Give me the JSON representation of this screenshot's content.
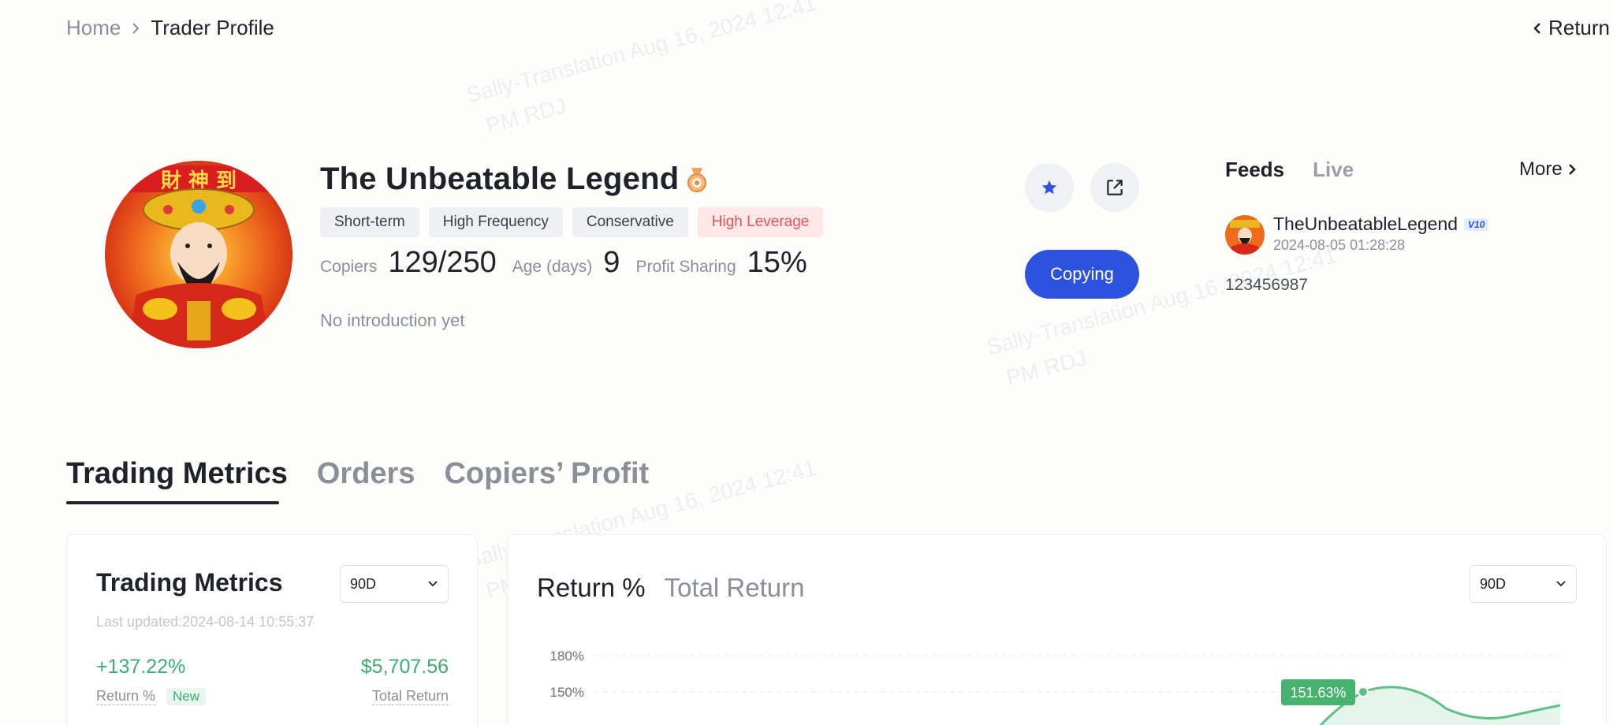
{
  "breadcrumb": {
    "home": "Home",
    "current": "Trader Profile"
  },
  "return_label": "Return",
  "profile": {
    "name": "The Unbeatable Legend",
    "tags": [
      {
        "label": "Short-term",
        "style": "neutral"
      },
      {
        "label": "High Frequency",
        "style": "neutral"
      },
      {
        "label": "Conservative",
        "style": "neutral"
      },
      {
        "label": "High Leverage",
        "style": "danger"
      }
    ],
    "copiers_label": "Copiers",
    "copiers_value": "129/250",
    "age_label": "Age (days)",
    "age_value": "9",
    "profit_label": "Profit Sharing",
    "profit_value": "15%",
    "introduction": "No introduction yet"
  },
  "actions": {
    "favorite_icon": "star-icon",
    "share_icon": "share-icon",
    "copy_label": "Copying"
  },
  "feeds": {
    "tabs": [
      "Feeds",
      "Live"
    ],
    "more_label": "More",
    "post": {
      "username": "TheUnbeatableLegend",
      "badge": "V10",
      "time": "2024-08-05 01:28:28",
      "content": "123456987"
    }
  },
  "main_tabs": [
    "Trading Metrics",
    "Orders",
    "Copiers’ Profit"
  ],
  "metrics": {
    "title": "Trading Metrics",
    "period": "90D",
    "updated": "Last updated:2024-08-14 10:55:37",
    "return_value": "+137.22%",
    "return_label": "Return %",
    "new_badge": "New",
    "total_value": "$5,707.56",
    "total_label": "Total Return"
  },
  "chart_panel": {
    "tabs": [
      "Return %",
      "Total Return"
    ],
    "period": "90D"
  },
  "chart_data": {
    "type": "area",
    "y_ticks": [
      "180%",
      "150%"
    ],
    "series": [
      {
        "values_visible": "curve cropped at bottom; peak label shown"
      }
    ],
    "peak_label": "151.63%",
    "peak_value": 151.63,
    "colors": {
      "line": "#5fbf86",
      "fill": "#e6f5ec",
      "label_bg": "#47b36f"
    }
  },
  "watermark": {
    "line1": "Sally-Translation Aug 16, 2024 12:41",
    "line2": "PM RDJ"
  },
  "colors": {
    "accent": "#2d52e0",
    "positive": "#3dac6f",
    "danger": "#e0565b"
  }
}
